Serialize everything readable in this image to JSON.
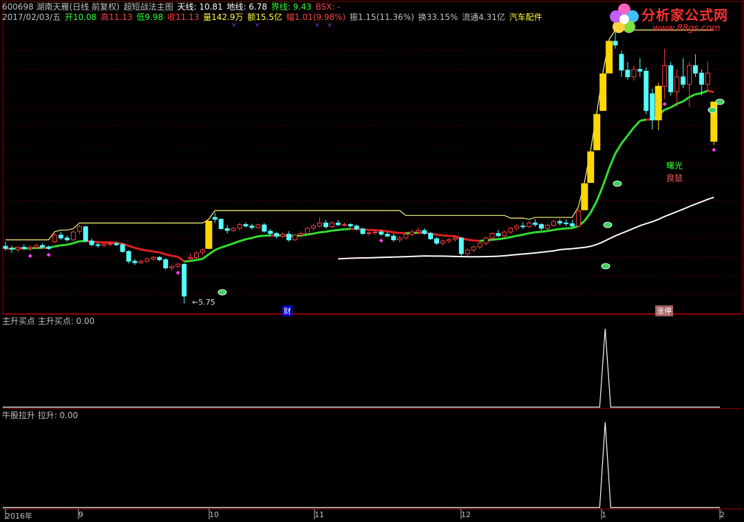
{
  "header": {
    "line1": {
      "code_name": "600698 湖南天雁(日线 前复权)",
      "indicator_name": "超短战法主图",
      "tianxian": "天线: 10.81",
      "dixian": "地线: 6.78",
      "jiexian": "界线: 9.43",
      "bsx": "BSX: -"
    },
    "line2": {
      "date": "2017/02/03/五",
      "open": "开10.08",
      "high": "高11.13",
      "low": "低9.98",
      "close": "收11.13",
      "volume": "量142.9万",
      "amount": "额15.5亿",
      "change": "幅1.01(9.98%)",
      "amplitude": "振1.15(11.36%)",
      "turnover": "换33.15%",
      "float": "流通4.31亿",
      "sector": "汽车配件"
    }
  },
  "logo": {
    "name": "分析家公式网",
    "url": "www.88gs.com"
  },
  "main_chart": {
    "low_annotation": "5.75",
    "tag_cai": "财",
    "tag_zhangting": "涨停",
    "signal_shuguang": "曙光",
    "signal_liangshu": "良鼠"
  },
  "panel2": {
    "title": "主升买点 主升买点: 0.00"
  },
  "panel3": {
    "title": "牛股拉升 拉升: 0.00"
  },
  "xaxis": {
    "labels": [
      "2016年",
      "9",
      "10",
      "11",
      "12",
      "1",
      "2"
    ]
  },
  "colors": {
    "up": "#ff4040",
    "down": "#54ffff",
    "yellow": "#ffd700",
    "tianxian": "#ffff80",
    "green": "#30e030",
    "red_line": "#e02020",
    "white": "#ffffff",
    "grid": "#7a0000",
    "magenta": "#ff40ff",
    "purple": "#8040ff"
  },
  "chart_data": {
    "type": "candlestick",
    "bars": [
      [
        7.28,
        7.4,
        7.16,
        7.22
      ],
      [
        7.22,
        7.3,
        7.1,
        7.2
      ],
      [
        7.2,
        7.28,
        7.12,
        7.25
      ],
      [
        7.25,
        7.33,
        7.18,
        7.22
      ],
      [
        7.22,
        7.3,
        7.15,
        7.25
      ],
      [
        7.25,
        7.35,
        7.2,
        7.3
      ],
      [
        7.3,
        7.36,
        7.22,
        7.26
      ],
      [
        7.26,
        7.3,
        7.18,
        7.22
      ],
      [
        7.4,
        7.62,
        7.35,
        7.58
      ],
      [
        7.58,
        7.66,
        7.45,
        7.5
      ],
      [
        7.5,
        7.57,
        7.4,
        7.45
      ],
      [
        7.45,
        7.7,
        7.42,
        7.66
      ],
      [
        7.68,
        7.85,
        7.6,
        7.8
      ],
      [
        7.8,
        7.82,
        7.38,
        7.42
      ],
      [
        7.42,
        7.48,
        7.28,
        7.32
      ],
      [
        7.32,
        7.38,
        7.24,
        7.3
      ],
      [
        7.3,
        7.38,
        7.25,
        7.34
      ],
      [
        7.34,
        7.42,
        7.28,
        7.35
      ],
      [
        7.35,
        7.4,
        7.28,
        7.32
      ],
      [
        7.32,
        7.36,
        7.1,
        7.14
      ],
      [
        7.14,
        7.18,
        6.82,
        6.88
      ],
      [
        6.88,
        6.94,
        6.78,
        6.84
      ],
      [
        6.84,
        6.92,
        6.8,
        6.88
      ],
      [
        6.88,
        6.98,
        6.84,
        6.94
      ],
      [
        6.94,
        7.02,
        6.9,
        6.98
      ],
      [
        6.98,
        7.02,
        6.88,
        6.92
      ],
      [
        6.92,
        6.96,
        6.66,
        6.7
      ],
      [
        6.7,
        6.78,
        6.62,
        6.74
      ],
      [
        6.74,
        6.84,
        6.7,
        6.8
      ],
      [
        6.8,
        6.82,
        5.75,
        5.95
      ],
      [
        6.95,
        7.08,
        6.88,
        6.98
      ],
      [
        6.98,
        7.14,
        6.94,
        7.1
      ],
      [
        7.12,
        7.22,
        7.05,
        7.18
      ],
      [
        7.22,
        7.95,
        7.2,
        7.95
      ],
      [
        8.05,
        8.18,
        7.9,
        8.0
      ],
      [
        8.0,
        8.02,
        7.72,
        7.75
      ],
      [
        7.75,
        7.85,
        7.62,
        7.7
      ],
      [
        7.7,
        7.8,
        7.65,
        7.76
      ],
      [
        7.76,
        7.9,
        7.7,
        7.86
      ],
      [
        7.86,
        7.92,
        7.78,
        7.82
      ],
      [
        7.82,
        7.88,
        7.72,
        7.78
      ],
      [
        7.78,
        7.88,
        7.74,
        7.85
      ],
      [
        7.85,
        7.9,
        7.64,
        7.68
      ],
      [
        7.68,
        7.74,
        7.55,
        7.62
      ],
      [
        7.62,
        7.66,
        7.48,
        7.55
      ],
      [
        7.55,
        7.65,
        7.5,
        7.6
      ],
      [
        7.6,
        7.68,
        7.4,
        7.45
      ],
      [
        7.45,
        7.6,
        7.42,
        7.58
      ],
      [
        7.58,
        7.68,
        7.52,
        7.62
      ],
      [
        7.62,
        7.8,
        7.58,
        7.76
      ],
      [
        7.76,
        7.88,
        7.7,
        7.82
      ],
      [
        7.82,
        8.05,
        7.78,
        7.9
      ],
      [
        7.9,
        7.98,
        7.75,
        7.8
      ],
      [
        7.8,
        7.94,
        7.76,
        7.9
      ],
      [
        7.9,
        7.98,
        7.82,
        7.85
      ],
      [
        7.85,
        7.92,
        7.8,
        7.86
      ],
      [
        7.86,
        7.9,
        7.78,
        7.82
      ],
      [
        7.82,
        7.86,
        7.7,
        7.74
      ],
      [
        7.74,
        7.78,
        7.58,
        7.62
      ],
      [
        7.62,
        7.68,
        7.56,
        7.64
      ],
      [
        7.64,
        7.7,
        7.58,
        7.66
      ],
      [
        7.66,
        7.72,
        7.56,
        7.6
      ],
      [
        7.6,
        7.66,
        7.52,
        7.55
      ],
      [
        7.55,
        7.62,
        7.4,
        7.45
      ],
      [
        7.45,
        7.55,
        7.38,
        7.5
      ],
      [
        7.5,
        7.64,
        7.46,
        7.6
      ],
      [
        7.6,
        7.72,
        7.54,
        7.66
      ],
      [
        7.66,
        7.78,
        7.6,
        7.7
      ],
      [
        7.7,
        7.76,
        7.58,
        7.62
      ],
      [
        7.62,
        7.66,
        7.44,
        7.48
      ],
      [
        7.48,
        7.52,
        7.32,
        7.36
      ],
      [
        7.36,
        7.46,
        7.3,
        7.42
      ],
      [
        7.42,
        7.5,
        7.36,
        7.46
      ],
      [
        7.46,
        7.55,
        7.4,
        7.5
      ],
      [
        7.5,
        7.52,
        7.02,
        7.08
      ],
      [
        7.08,
        7.22,
        7.02,
        7.18
      ],
      [
        7.18,
        7.3,
        7.12,
        7.26
      ],
      [
        7.26,
        7.4,
        7.2,
        7.36
      ],
      [
        7.36,
        7.54,
        7.3,
        7.5
      ],
      [
        7.5,
        7.66,
        7.44,
        7.62
      ],
      [
        7.62,
        7.72,
        7.52,
        7.56
      ],
      [
        7.56,
        7.7,
        7.5,
        7.66
      ],
      [
        7.66,
        7.8,
        7.6,
        7.76
      ],
      [
        7.76,
        7.86,
        7.7,
        7.82
      ],
      [
        7.82,
        7.92,
        7.74,
        7.8
      ],
      [
        7.8,
        7.95,
        7.76,
        7.9
      ],
      [
        7.9,
        8.0,
        7.8,
        7.86
      ],
      [
        7.86,
        7.9,
        7.7,
        7.76
      ],
      [
        7.76,
        7.88,
        7.7,
        7.84
      ],
      [
        7.84,
        7.98,
        7.8,
        7.94
      ],
      [
        7.94,
        8.0,
        7.84,
        7.9
      ],
      [
        7.9,
        8.0,
        7.82,
        7.88
      ],
      [
        7.88,
        7.98,
        7.78,
        7.82
      ],
      [
        7.82,
        8.28,
        7.8,
        8.22
      ],
      [
        8.25,
        8.95,
        8.25,
        8.95
      ],
      [
        8.98,
        9.8,
        8.98,
        9.8
      ],
      [
        9.85,
        10.8,
        9.85,
        10.8
      ],
      [
        10.9,
        11.88,
        10.9,
        11.88
      ],
      [
        11.9,
        12.75,
        11.9,
        12.75
      ],
      [
        12.75,
        13.0,
        12.55,
        12.65
      ],
      [
        12.4,
        12.5,
        11.8,
        11.98
      ],
      [
        11.98,
        12.2,
        11.72,
        11.8
      ],
      [
        11.8,
        12.1,
        11.7,
        12.0
      ],
      [
        12.0,
        12.3,
        11.8,
        11.95
      ],
      [
        11.95,
        12.05,
        10.8,
        10.9
      ],
      [
        11.35,
        11.48,
        10.4,
        10.65
      ],
      [
        10.65,
        11.65,
        10.38,
        11.55
      ],
      [
        11.55,
        12.55,
        11.2,
        12.1
      ],
      [
        12.1,
        12.2,
        11.3,
        11.4
      ],
      [
        11.4,
        12.0,
        11.0,
        11.8
      ],
      [
        11.8,
        12.3,
        11.5,
        11.6
      ],
      [
        11.6,
        12.2,
        11.0,
        12.1
      ],
      [
        12.1,
        12.4,
        11.8,
        11.9
      ],
      [
        11.9,
        12.0,
        11.3,
        11.6
      ],
      [
        11.6,
        12.2,
        11.4,
        11.9
      ],
      [
        10.08,
        11.13,
        9.98,
        11.13
      ]
    ],
    "ylim": [
      5.5,
      13.3
    ],
    "zhusheng_buy_index": 94,
    "lasheng_index": 94,
    "zhusheng_buy_value": 0.0,
    "lasheng_value": 0.0
  }
}
